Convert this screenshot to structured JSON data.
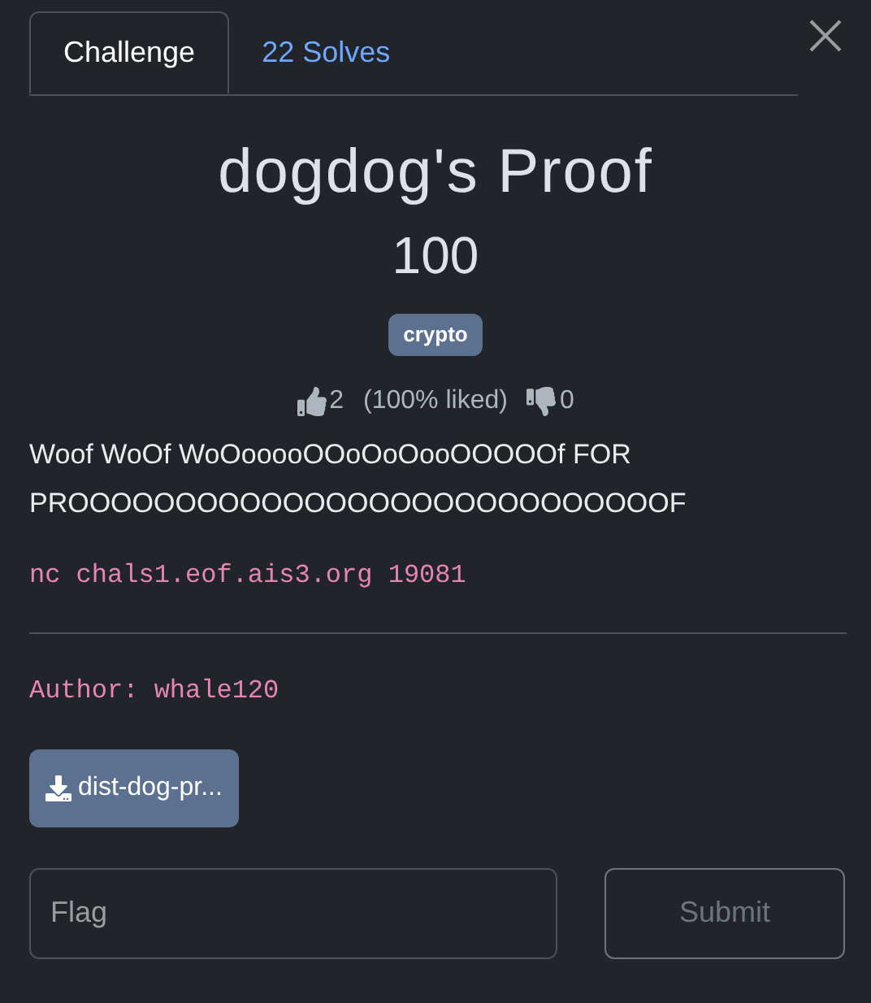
{
  "tabs": [
    {
      "label": "Challenge",
      "selected": true
    },
    {
      "label": "22 Solves",
      "selected": false
    }
  ],
  "title": "dogdog's Proof",
  "points": "100",
  "tags": [
    "crypto"
  ],
  "votes": {
    "likes": "2",
    "ratio": "(100% liked)",
    "dislikes": "0"
  },
  "description": "Woof WoOf WoOooooOOoOoOooOOOOOf FOR PROOOOOOOOOOOOOOOOOOOOOOOOOOOOF",
  "connection": "nc chals1.eof.ais3.org 19081",
  "author": "Author: whale120",
  "files": [
    "dist-dog-pr..."
  ],
  "flag_field": {
    "placeholder": "Flag"
  },
  "submit": {
    "label": "Submit",
    "disabled": true
  }
}
